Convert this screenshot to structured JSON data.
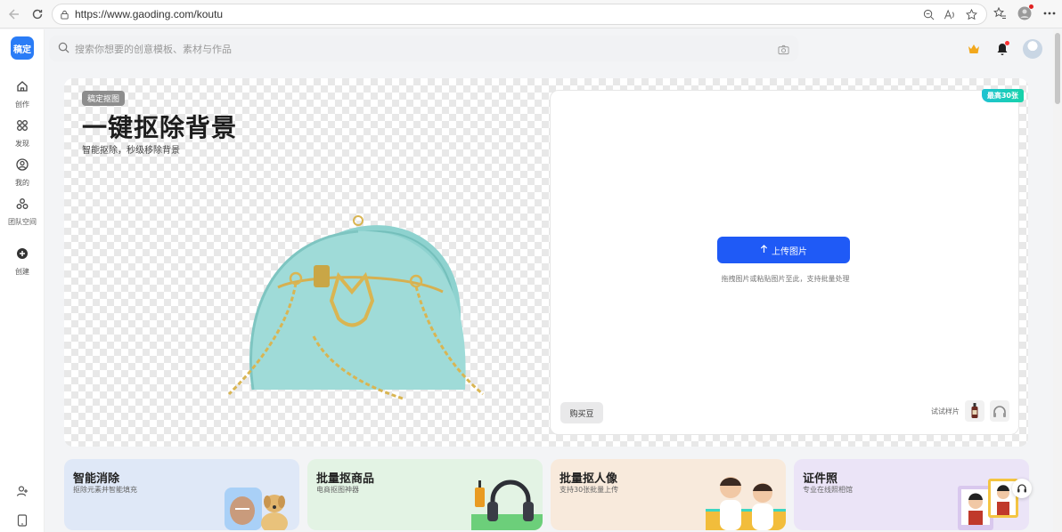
{
  "browser": {
    "url": "https://www.gaoding.com/koutu"
  },
  "sidebar": {
    "logo": "稿定",
    "items": [
      {
        "label": "创作",
        "icon": "home-icon"
      },
      {
        "label": "发现",
        "icon": "discover-icon"
      },
      {
        "label": "我的",
        "icon": "user-icon"
      },
      {
        "label": "团队空间",
        "icon": "team-icon"
      },
      {
        "label": "创建",
        "icon": "plus-circle-icon"
      }
    ]
  },
  "header": {
    "search_placeholder": "搜索你想要的创意模板、素材与作品"
  },
  "hero": {
    "badge": "稿定抠图",
    "title": "一键抠除背景",
    "subtitle": "智能抠除，秒级移除背景"
  },
  "upload": {
    "ribbon": "最高30张",
    "button_label": "上传图片",
    "hint": "拖拽图片或粘贴图片至此，支持批量处理",
    "buy_label": "购买豆",
    "samples_label": "试试样片"
  },
  "cards": [
    {
      "title": "智能消除",
      "subtitle": "抠除元素并智能填充",
      "bg": "#dfe8f7"
    },
    {
      "title": "批量抠商品",
      "subtitle": "电商抠图神器",
      "bg": "#e3f3e4"
    },
    {
      "title": "批量抠人像",
      "subtitle": "支持30张批量上传",
      "bg": "#f8eadc"
    },
    {
      "title": "证件照",
      "subtitle": "专业在线照相馆",
      "bg": "#ebe4f7"
    }
  ],
  "colors": {
    "primary": "#1f5af6",
    "ribbon": "#1fc2d2"
  }
}
